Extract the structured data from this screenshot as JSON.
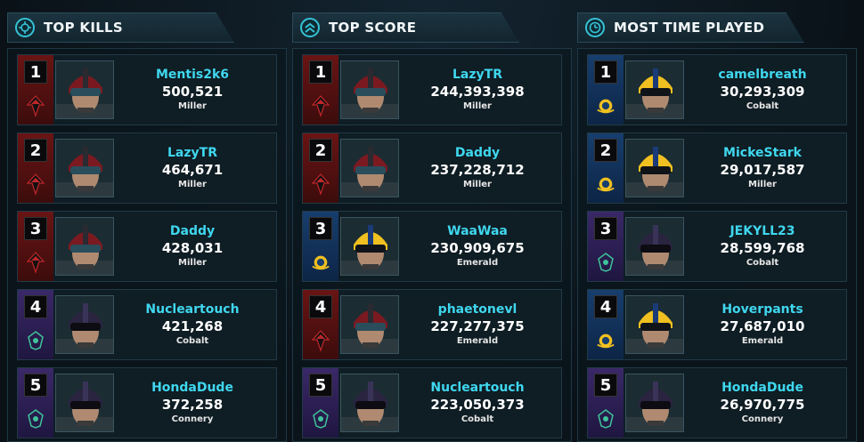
{
  "columns": [
    {
      "title": "TOP KILLS",
      "icon": "crosshair-icon",
      "rows": [
        {
          "rank": "1",
          "name": "Mentis2k6",
          "value": "500,521",
          "server": "Miller",
          "faction": "tr"
        },
        {
          "rank": "2",
          "name": "LazyTR",
          "value": "464,671",
          "server": "Miller",
          "faction": "tr"
        },
        {
          "rank": "3",
          "name": "Daddy",
          "value": "428,031",
          "server": "Miller",
          "faction": "tr"
        },
        {
          "rank": "4",
          "name": "Nucleartouch",
          "value": "421,268",
          "server": "Cobalt",
          "faction": "vs"
        },
        {
          "rank": "5",
          "name": "HondaDude",
          "value": "372,258",
          "server": "Connery",
          "faction": "vs"
        }
      ]
    },
    {
      "title": "TOP SCORE",
      "icon": "chevrons-up-icon",
      "rows": [
        {
          "rank": "1",
          "name": "LazyTR",
          "value": "244,393,398",
          "server": "Miller",
          "faction": "tr"
        },
        {
          "rank": "2",
          "name": "Daddy",
          "value": "237,228,712",
          "server": "Miller",
          "faction": "tr"
        },
        {
          "rank": "3",
          "name": "WaaWaa",
          "value": "230,909,675",
          "server": "Emerald",
          "faction": "nc"
        },
        {
          "rank": "4",
          "name": "phaetonevl",
          "value": "227,277,375",
          "server": "Emerald",
          "faction": "tr"
        },
        {
          "rank": "5",
          "name": "Nucleartouch",
          "value": "223,050,373",
          "server": "Cobalt",
          "faction": "vs"
        }
      ]
    },
    {
      "title": "MOST TIME PLAYED",
      "icon": "clock-icon",
      "rows": [
        {
          "rank": "1",
          "name": "camelbreath",
          "value": "30,293,309",
          "server": "Cobalt",
          "faction": "nc"
        },
        {
          "rank": "2",
          "name": "MickeStark",
          "value": "29,017,587",
          "server": "Miller",
          "faction": "nc"
        },
        {
          "rank": "3",
          "name": "JEKYLL23",
          "value": "28,599,768",
          "server": "Cobalt",
          "faction": "vs"
        },
        {
          "rank": "4",
          "name": "Hoverpants",
          "value": "27,687,010",
          "server": "Emerald",
          "faction": "nc"
        },
        {
          "rank": "5",
          "name": "HondaDude",
          "value": "26,970,775",
          "server": "Connery",
          "faction": "vs"
        }
      ]
    }
  ],
  "colors": {
    "accent": "#3fd7ef",
    "tr": "#6a1414",
    "nc": "#173e6e",
    "vs": "#3a2868"
  }
}
